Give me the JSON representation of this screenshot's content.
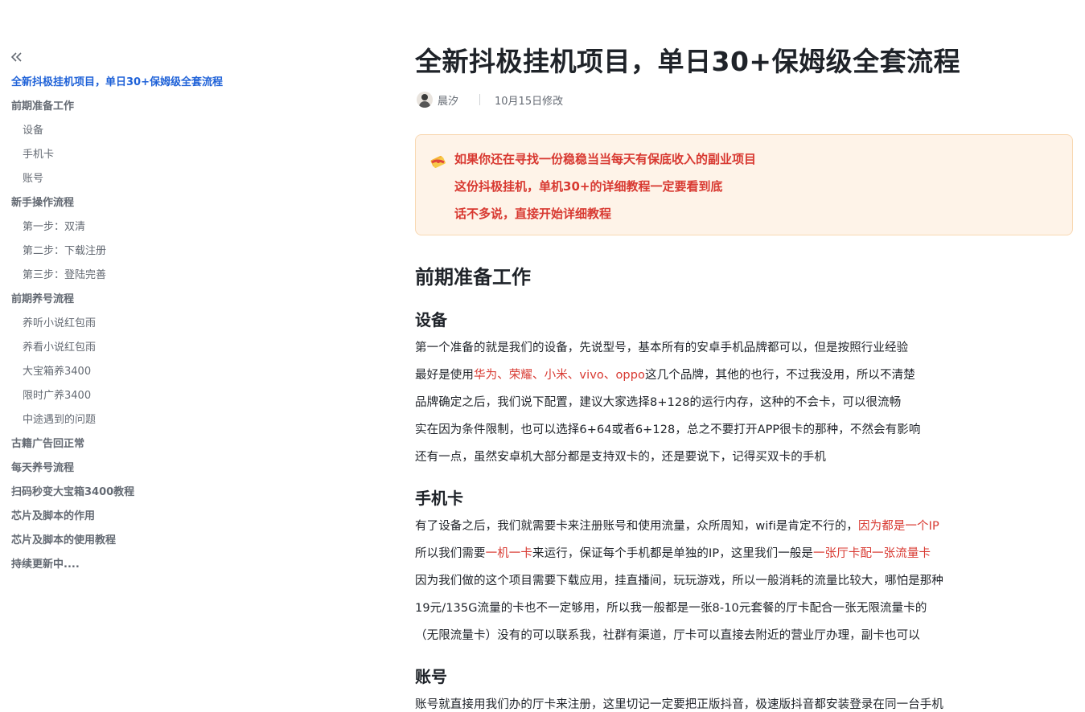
{
  "sidebar": {
    "collapse_label": "«",
    "toc": [
      {
        "label": "全新抖极挂机项目，单日30+保姆级全套流程",
        "level": 1,
        "active": true
      },
      {
        "label": "前期准备工作",
        "level": 1
      },
      {
        "label": "设备",
        "level": 2
      },
      {
        "label": "手机卡",
        "level": 2
      },
      {
        "label": "账号",
        "level": 2
      },
      {
        "label": "新手操作流程",
        "level": 1
      },
      {
        "label": "第一步：双清",
        "level": 2
      },
      {
        "label": "第二步：下载注册",
        "level": 2
      },
      {
        "label": "第三步：登陆完善",
        "level": 2
      },
      {
        "label": "前期养号流程",
        "level": 1
      },
      {
        "label": "养听小说红包雨",
        "level": 2
      },
      {
        "label": "养看小说红包雨",
        "level": 2
      },
      {
        "label": "大宝箱养3400",
        "level": 2
      },
      {
        "label": "限时广养3400",
        "level": 2
      },
      {
        "label": "中途遇到的问题",
        "level": 2
      },
      {
        "label": "古籍广告回正常",
        "level": 1
      },
      {
        "label": "每天养号流程",
        "level": 1
      },
      {
        "label": "扫码秒变大宝箱3400教程",
        "level": 1
      },
      {
        "label": "芯片及脚本的作用",
        "level": 1
      },
      {
        "label": "芯片及脚本的使用教程",
        "level": 1
      },
      {
        "label": "持续更新中....",
        "level": 1
      }
    ]
  },
  "doc": {
    "title": "全新抖极挂机项目，单日30+保姆级全套流程",
    "author": "晨汐",
    "modified": "10月15日修改",
    "callout": {
      "icon": "money-icon",
      "lines": [
        "如果你还在寻找一份稳稳当当每天有保底收入的副业项目",
        "这份抖极挂机，单机30+的详细教程一定要看到底",
        "话不多说，直接开始详细教程"
      ]
    },
    "section_prep": "前期准备工作",
    "device": {
      "heading": "设备",
      "p1": "第一个准备的就是我们的设备，先说型号，基本所有的安卓手机品牌都可以，但是按照行业经验",
      "p2_a": "最好是使用",
      "p2_red": "华为、荣耀、小米、vivo、oppo",
      "p2_b": "这几个品牌，其他的也行，不过我没用，所以不清楚",
      "p3": "品牌确定之后，我们说下配置，建议大家选择8+128的运行内存，这种的不会卡，可以很流畅",
      "p4": "实在因为条件限制，也可以选择6+64或者6+128，总之不要打开APP很卡的那种，不然会有影响",
      "p5": "还有一点，虽然安卓机大部分都是支持双卡的，还是要说下，记得买双卡的手机"
    },
    "sim": {
      "heading": "手机卡",
      "p1_a": "有了设备之后，我们就需要卡来注册账号和使用流量，众所周知，wifi是肯定不行的，",
      "p1_red": "因为都是一个IP",
      "p2_a": "所以我们需要",
      "p2_red1": "一机一卡",
      "p2_b": "来运行，保证每个手机都是单独的IP，这里我们一般是",
      "p2_red2": "一张厅卡配一张流量卡",
      "p3": "因为我们做的这个项目需要下载应用，挂直播间，玩玩游戏，所以一般消耗的流量比较大，哪怕是那种",
      "p4": "19元/135G流量的卡也不一定够用，所以我一般都是一张8-10元套餐的厅卡配合一张无限流量卡的",
      "p5": "（无限流量卡）没有的可以联系我，社群有渠道，厅卡可以直接去附近的营业厅办理，副卡也可以"
    },
    "account": {
      "heading": "账号",
      "p1": "账号就直接用我们办的厅卡来注册，这里切记一定要把正版抖音，极速版抖音都安装登录在同一台手机"
    }
  }
}
